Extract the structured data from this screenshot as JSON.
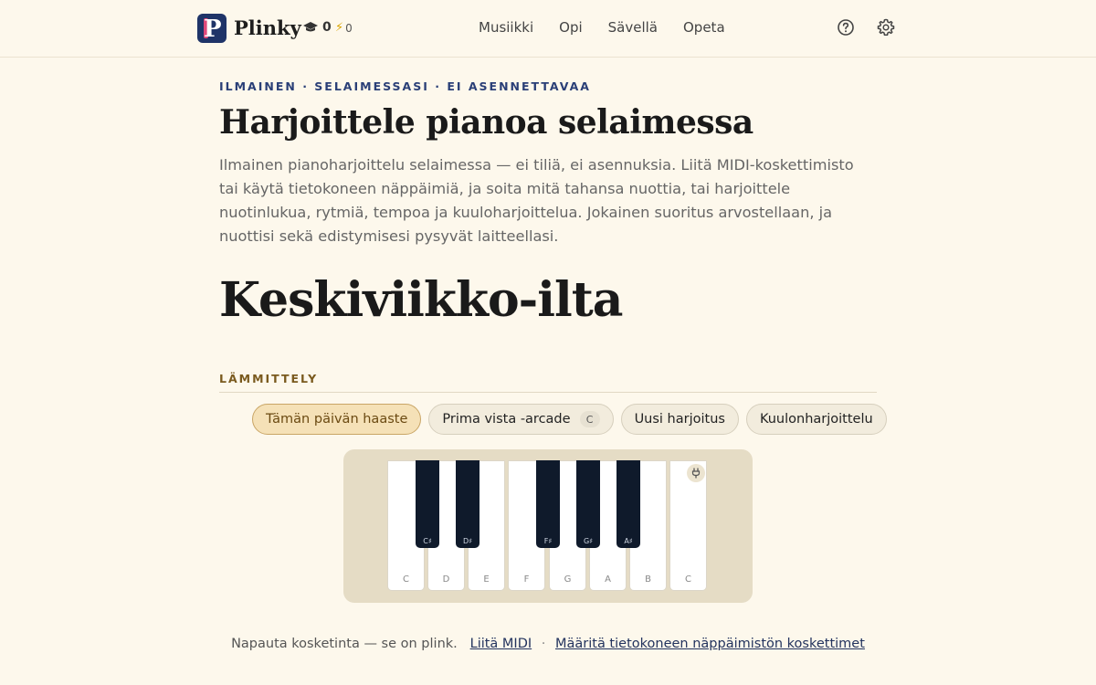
{
  "header": {
    "brand": "Plinky",
    "stats": {
      "lessons": "0",
      "streak": "0"
    },
    "nav": [
      "Musiikki",
      "Opi",
      "Sävellä",
      "Opeta"
    ]
  },
  "hero": {
    "eyebrow": "ILMAINEN · SELAIMESSASI · EI ASENNETTAVAA",
    "title": "Harjoittele pianoa selaimessa",
    "lead": "Ilmainen pianoharjoittelu selaimessa — ei tiliä, ei asennuksia. Liitä MIDI-koskettimisto tai käytä tietokoneen näppäimiä, ja soita mitä tahansa nuottia, tai harjoittele nuotinlukua, rytmiä, tempoa ja kuuloharjoittelua. Jokainen suoritus arvostellaan, ja nuottisi sekä edistymisesi pysyvät laitteellasi."
  },
  "greeting": "Keskiviikko-ilta",
  "warmup": {
    "label": "LÄMMITTELY",
    "chips": [
      {
        "label": "Tämän päivän haaste",
        "active": true
      },
      {
        "label": "Prima vista -arcade",
        "badge": "C"
      },
      {
        "label": "Uusi harjoitus"
      },
      {
        "label": "Kuulonharjoittelu"
      }
    ]
  },
  "piano": {
    "white_keys": [
      "C",
      "D",
      "E",
      "F",
      "G",
      "A",
      "B",
      "C"
    ],
    "black_keys": [
      "C♯",
      "D♯",
      "F♯",
      "G♯",
      "A♯"
    ]
  },
  "footer": {
    "hint": "Napauta kosketinta — se on plink.",
    "link_midi": "Liitä MIDI",
    "separator": "·",
    "link_keys": "Määritä tietokoneen näppäimistön koskettimet"
  },
  "colors": {
    "background": "#fdf8ec",
    "brand": "#1f3468",
    "accent_active": "#f5e1b7",
    "black_key": "#0f1a2b"
  }
}
